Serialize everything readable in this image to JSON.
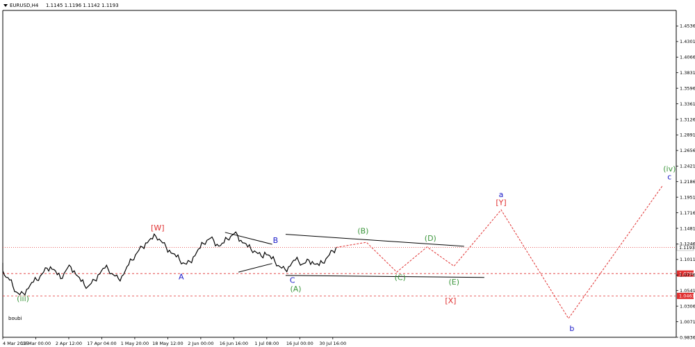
{
  "header": {
    "symbol": "EURUSD,H4",
    "ohlc": "1.1145 1.1196 1.1142 1.1193"
  },
  "watermark": "boubi",
  "colors": {
    "green": "#3c963c",
    "red": "#e03030",
    "blue": "#1818c8",
    "price": "#000000",
    "grid": "#e8e8e8"
  },
  "chart_data": {
    "type": "line",
    "title": "",
    "xlabel": "",
    "ylabel": "",
    "ylim": [
      0.9836,
      1.4771
    ],
    "grid": false,
    "x_ticks": [
      "4 Mar 2015",
      "19 Mar 00:00",
      "2 Apr 12:00",
      "17 Apr 04:00",
      "1 May 20:00",
      "18 May 12:00",
      "2 Jun 00:00",
      "16 Jun 16:00",
      "1 Jul 08:00",
      "16 Jul 00:00",
      "30 Jul 16:00"
    ],
    "y_ticks": [
      "1.4536",
      "1.4301",
      "1.4066",
      "1.3831",
      "1.3596",
      "1.3361",
      "1.3126",
      "1.2891",
      "1.2656",
      "1.2421",
      "1.2186",
      "1.1951",
      "1.1716",
      "1.1481",
      "1.1246",
      "1.1011",
      "1.0776",
      "1.0541",
      "1.0306",
      "1.0071",
      "0.9836"
    ],
    "price_highlights": [
      {
        "text": "1.1193",
        "value": 1.1193
      },
      {
        "text": "1.0798",
        "value": 1.0798
      },
      {
        "text": "1.0461",
        "value": 1.0461
      }
    ],
    "h_lines": [
      {
        "value": 1.1193,
        "style": "dotted-red"
      },
      {
        "value": 1.0798,
        "style": "dashed-red"
      },
      {
        "value": 1.0461,
        "style": "dashed-red"
      }
    ],
    "price_series": [
      1.096,
      1.084,
      1.074,
      1.07,
      1.06,
      1.052,
      1.048,
      1.05,
      1.056,
      1.062,
      1.067,
      1.07,
      1.076,
      1.082,
      1.088,
      1.09,
      1.086,
      1.078,
      1.072,
      1.08,
      1.088,
      1.09,
      1.084,
      1.076,
      1.068,
      1.062,
      1.06,
      1.065,
      1.07,
      1.078,
      1.084,
      1.088,
      1.086,
      1.08,
      1.076,
      1.072,
      1.076,
      1.084,
      1.093,
      1.1,
      1.108,
      1.115,
      1.12,
      1.126,
      1.13,
      1.132,
      1.136,
      1.132,
      1.126,
      1.12,
      1.115,
      1.11,
      1.105,
      1.1,
      1.096,
      1.094,
      1.098,
      1.105,
      1.112,
      1.118,
      1.125,
      1.13,
      1.133,
      1.13,
      1.124,
      1.122,
      1.126,
      1.132,
      1.136,
      1.14,
      1.138,
      1.13,
      1.126,
      1.12,
      1.116,
      1.114,
      1.11,
      1.106,
      1.112,
      1.108,
      1.102,
      1.098,
      1.092,
      1.088,
      1.086,
      1.09,
      1.096,
      1.1,
      1.098,
      1.094,
      1.096,
      1.1,
      1.098,
      1.094,
      1.092,
      1.096,
      1.102,
      1.108,
      1.114,
      1.1193
    ],
    "x_range": [
      0,
      100
    ],
    "zigzag_red": [
      [
        99,
        1.1193
      ],
      [
        108,
        1.127
      ],
      [
        117,
        1.082
      ],
      [
        126,
        1.12
      ],
      [
        134,
        1.091
      ],
      [
        148,
        1.176
      ],
      [
        168,
        1.012
      ],
      [
        196,
        1.213
      ]
    ],
    "trendlines": [
      {
        "from": [
          66,
          1.142
        ],
        "to": [
          80,
          1.124
        ]
      },
      {
        "from": [
          70,
          1.082
        ],
        "to": [
          80,
          1.095
        ]
      },
      {
        "from": [
          84,
          1.139
        ],
        "to": [
          137,
          1.121
        ]
      },
      {
        "from": [
          84,
          1.077
        ],
        "to": [
          143,
          1.074
        ]
      }
    ],
    "annotations": [
      {
        "text": "(iii)",
        "x": 6,
        "y": 1.038,
        "color": "green"
      },
      {
        "text": "[W]",
        "x": 46,
        "y": 1.145,
        "color": "red"
      },
      {
        "text": "A",
        "x": 53,
        "y": 1.071,
        "color": "blue"
      },
      {
        "text": "B",
        "x": 81,
        "y": 1.126,
        "color": "blue"
      },
      {
        "text": "C",
        "x": 86,
        "y": 1.066,
        "color": "blue"
      },
      {
        "text": "(A)",
        "x": 87,
        "y": 1.053,
        "color": "green"
      },
      {
        "text": "(B)",
        "x": 107,
        "y": 1.14,
        "color": "green"
      },
      {
        "text": "(C)",
        "x": 118,
        "y": 1.07,
        "color": "green"
      },
      {
        "text": "(D)",
        "x": 127,
        "y": 1.129,
        "color": "green"
      },
      {
        "text": "(E)",
        "x": 134,
        "y": 1.063,
        "color": "green"
      },
      {
        "text": "[X]",
        "x": 133,
        "y": 1.035,
        "color": "red"
      },
      {
        "text": "a",
        "x": 148,
        "y": 1.195,
        "color": "blue"
      },
      {
        "text": "[Y]",
        "x": 148,
        "y": 1.183,
        "color": "red"
      },
      {
        "text": "b",
        "x": 169,
        "y": 0.993,
        "color": "blue"
      },
      {
        "text": "(iv)",
        "x": 198,
        "y": 1.234,
        "color": "green"
      },
      {
        "text": "c",
        "x": 198,
        "y": 1.222,
        "color": "blue"
      }
    ]
  }
}
